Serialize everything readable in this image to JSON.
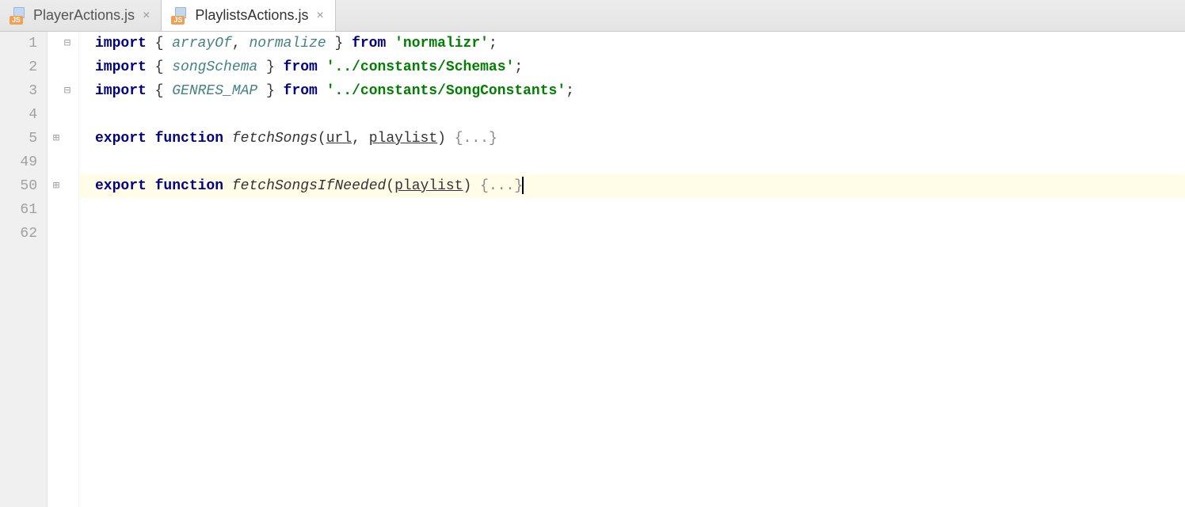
{
  "tabs": [
    {
      "label": "PlayerActions.js",
      "active": false
    },
    {
      "label": "PlaylistsActions.js",
      "active": true
    }
  ],
  "gutter": [
    "1",
    "2",
    "3",
    "4",
    "5",
    "49",
    "50",
    "61",
    "62"
  ],
  "code": {
    "l1": {
      "kw1": "import",
      "brace_open": " { ",
      "id1": "arrayOf",
      "comma": ", ",
      "id2": "normalize",
      "brace_close": " } ",
      "kw2": "from",
      "space": " ",
      "str": "'normalizr'",
      "semi": ";"
    },
    "l2": {
      "kw1": "import",
      "brace_open": " { ",
      "id1": "songSchema",
      "brace_close": " } ",
      "kw2": "from",
      "space": " ",
      "str": "'../constants/Schemas'",
      "semi": ";"
    },
    "l3": {
      "kw1": "import",
      "brace_open": " { ",
      "id1": "GENRES_MAP",
      "brace_close": " } ",
      "kw2": "from",
      "space": " ",
      "str": "'../constants/SongConstants'",
      "semi": ";"
    },
    "l5": {
      "kw1": "export",
      "space1": " ",
      "kw2": "function",
      "space2": " ",
      "fn": "fetchSongs",
      "paren_open": "(",
      "p1": "url",
      "comma": ", ",
      "p2": "playlist",
      "paren_close": ") ",
      "folded": "{...}"
    },
    "l50": {
      "kw1": "export",
      "space1": " ",
      "kw2": "function",
      "space2": " ",
      "fn": "fetchSongsIfNeeded",
      "paren_open": "(",
      "p1": "playlist",
      "paren_close": ") ",
      "folded": "{...}"
    }
  },
  "fold_marks": {
    "l1_minus": "⊟",
    "l3_minus": "⊟",
    "l5_plus": "⊞",
    "l50_plus": "⊞"
  }
}
